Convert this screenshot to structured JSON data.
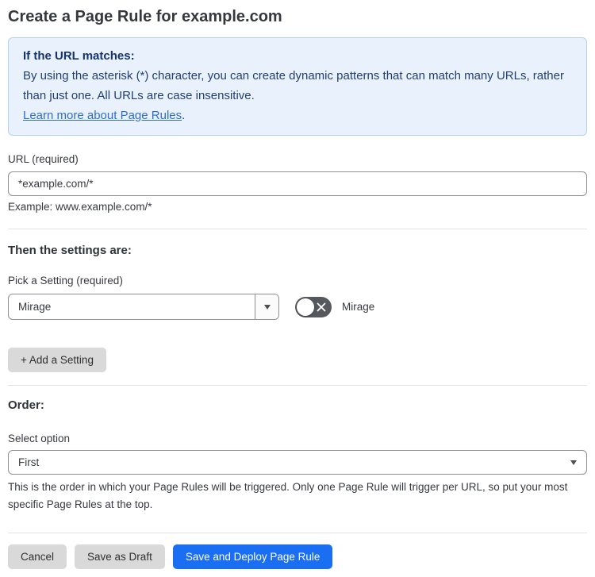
{
  "page": {
    "title": "Create a Page Rule for example.com"
  },
  "info_box": {
    "heading": "If the URL matches:",
    "body": "By using the asterisk (*) character, you can create dynamic patterns that can match many URLs, rather than just one. All URLs are case insensitive.",
    "link_label": "Learn more about Page Rules",
    "link_suffix": "."
  },
  "url_field": {
    "label": "URL (required)",
    "value": "*example.com/*",
    "helper": "Example: www.example.com/*"
  },
  "settings_section": {
    "heading": "Then the settings are:",
    "setting_label": "Pick a Setting (required)",
    "setting_value": "Mirage",
    "toggle_label": "Mirage",
    "toggle_state": "off",
    "add_setting_label": "+ Add a Setting"
  },
  "order_section": {
    "heading": "Order:",
    "select_label": "Select option",
    "select_value": "First",
    "helper": "This is the order in which your Page Rules will be triggered. Only one Page Rule will trigger per URL, so put your most specific Page Rules at the top."
  },
  "footer": {
    "cancel_label": "Cancel",
    "save_draft_label": "Save as Draft",
    "save_deploy_label": "Save and Deploy Page Rule"
  },
  "colors": {
    "accent_blue": "#1a6ef2",
    "info_bg": "#e9f2fc",
    "info_border": "#b3d2f1",
    "info_text": "#223f72",
    "link_blue": "#2f6cd0",
    "toggle_off_bg": "#55585d",
    "button_gray": "#d9d9d9",
    "divider": "#e3e3e3"
  }
}
